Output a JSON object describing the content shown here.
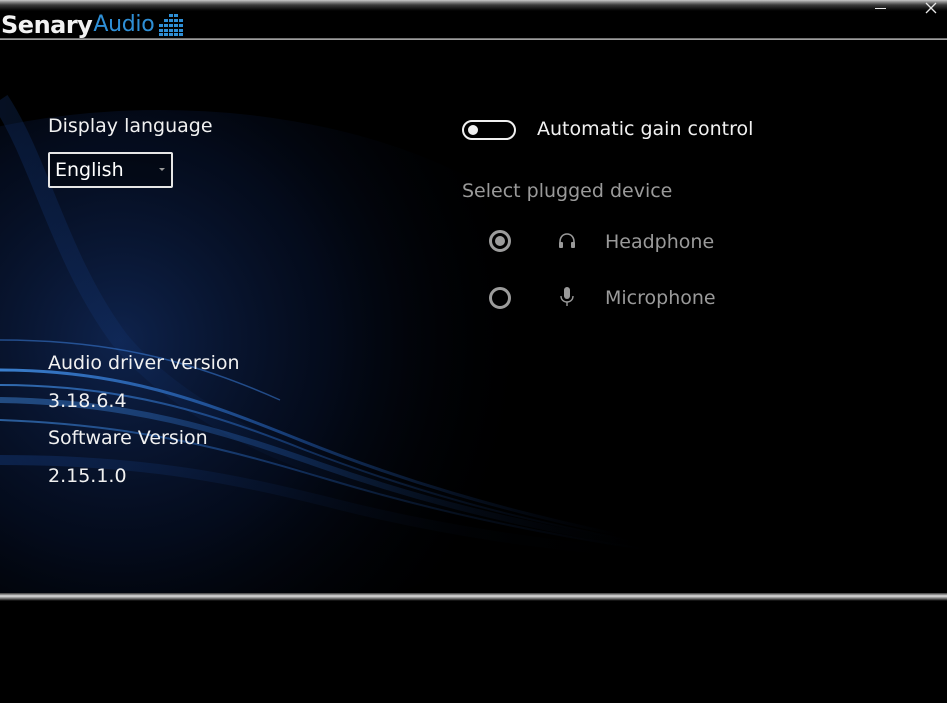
{
  "app": {
    "logo_primary": "Senary",
    "logo_secondary": "Audio",
    "minimize_glyph": "",
    "close_glyph": "✕",
    "accent_color": "#2e8fd6"
  },
  "language": {
    "label": "Display language",
    "selected": "English"
  },
  "agc": {
    "label": "Automatic gain control",
    "enabled": false
  },
  "devices": {
    "heading": "Select plugged device",
    "items": [
      {
        "label": "Headphone",
        "icon": "headphone-icon",
        "selected": true
      },
      {
        "label": "Microphone",
        "icon": "microphone-icon",
        "selected": false
      }
    ]
  },
  "versions": {
    "driver_label": "Audio driver version",
    "driver_value": "3.18.6.4",
    "software_label": "Software Version",
    "software_value": "2.15.1.0"
  }
}
